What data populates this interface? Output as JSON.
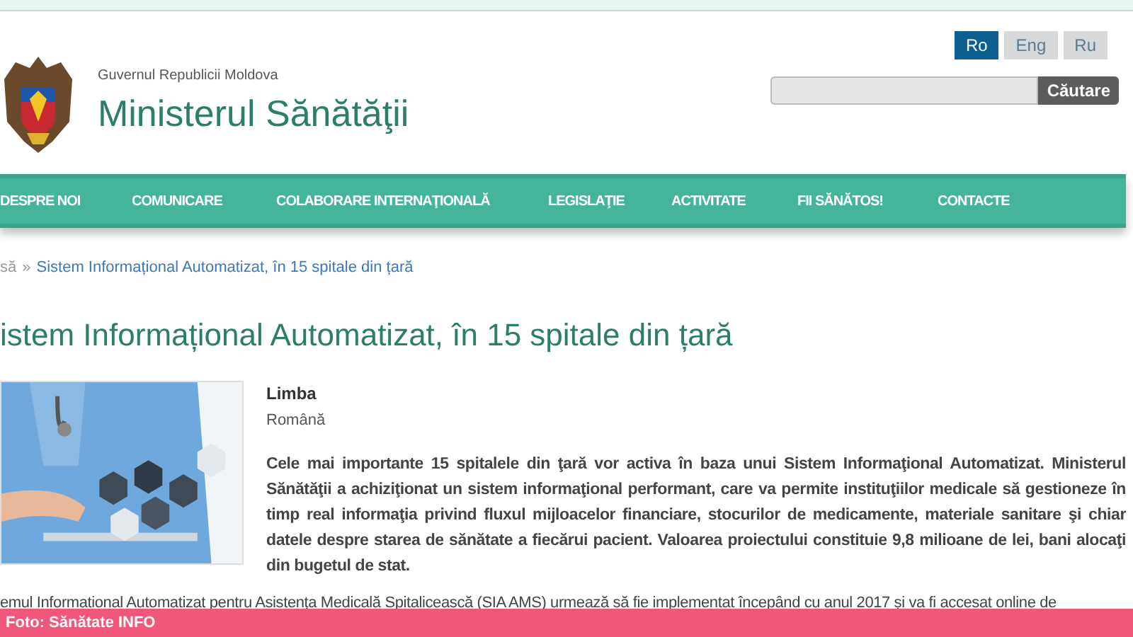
{
  "header": {
    "subtitle": "Guvernul Republicii Moldova",
    "title": "Ministerul Sănătăţii"
  },
  "languages": [
    {
      "label": "Ro",
      "selected": true
    },
    {
      "label": "Eng",
      "selected": false
    },
    {
      "label": "Ru",
      "selected": false
    }
  ],
  "search": {
    "button": "Căutare"
  },
  "nav": [
    {
      "label": "DESPRE NOI"
    },
    {
      "label": "COMUNICARE"
    },
    {
      "label": "COLABORARE INTERNAŢIONALĂ"
    },
    {
      "label": "LEGISLAŢIE"
    },
    {
      "label": "ACTIVITATE"
    },
    {
      "label": "FII SĂNĂTOS!"
    },
    {
      "label": "CONTACTE"
    }
  ],
  "breadcrumb_separator": "»",
  "breadcrumb": [
    {
      "label": "să"
    },
    {
      "label": "Sistem Informațional Automatizat, în 15 spitale din țară"
    }
  ],
  "article": {
    "title": "istem Informațional Automatizat, în 15 spitale din țară",
    "language_label": "Limba",
    "language_value": "Română",
    "lead": "Cele mai importante 15 spitalele din ţară vor activa în baza unui Sistem Informaţional Automatizat. Ministerul Sănătăţii a achiziţionat un sistem informaţional performant, care va permite instituţiilor medicale să gestioneze în timp real informaţia privind fluxul mijloacelor financiare, stocurilor de medicamente, materiale sanitare şi chiar datele despre starea de sănătate a fiecărui pacient. Valoarea proiectului constituie 9,8 milioane de lei, bani alocaţi din bugetul de stat.",
    "body": [
      "emul Informational Automatizat pentru Asistența Medicală Spitalicească (SIA AMS) urmează să fie implementat începând cu anul 2017 și va fi accesat online de"
    ]
  },
  "photo_credit": "Foto: Sănătate INFO"
}
